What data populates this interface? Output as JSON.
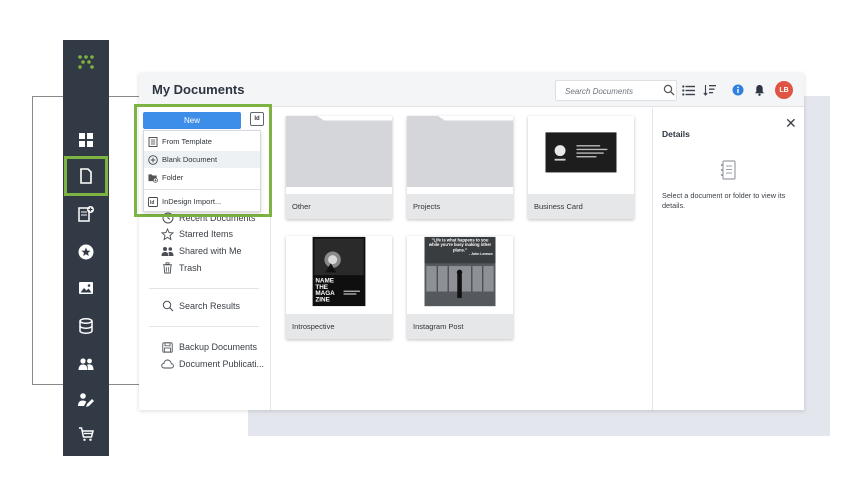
{
  "app": {
    "title": "My Documents",
    "logo_icon": "apps-logo-icon"
  },
  "rail": {
    "items": [
      {
        "icon": "dashboard-icon"
      },
      {
        "icon": "document-icon",
        "active": true
      },
      {
        "icon": "add-document-icon"
      },
      {
        "icon": "star-badge-icon"
      },
      {
        "icon": "image-icon"
      },
      {
        "icon": "database-icon"
      },
      {
        "icon": "users-icon"
      },
      {
        "icon": "user-edit-icon"
      },
      {
        "icon": "cart-icon"
      }
    ],
    "accent": "#7cb342"
  },
  "header": {
    "search_placeholder": "Search Documents",
    "avatar_initials": "LB",
    "avatar_color": "#e05444",
    "info_color": "#2f7fe0"
  },
  "new_menu": {
    "new_label": "New",
    "id_label": "Id",
    "items": [
      {
        "label": "From Template",
        "icon": "template-icon"
      },
      {
        "label": "Blank Document",
        "icon": "plus-circle-icon"
      },
      {
        "label": "Folder",
        "icon": "folder-add-icon"
      },
      {
        "label": "InDesign Import...",
        "icon": "indesign-icon"
      }
    ]
  },
  "sidebar": {
    "items": [
      {
        "label": "Recent Documents",
        "icon": "clock-icon"
      },
      {
        "label": "Starred Items",
        "icon": "star-icon"
      },
      {
        "label": "Shared with Me",
        "icon": "shared-users-icon"
      },
      {
        "label": "Trash",
        "icon": "trash-icon"
      },
      {
        "label": "Search Results",
        "icon": "search-icon"
      },
      {
        "label": "Backup Documents",
        "icon": "backup-icon"
      },
      {
        "label": "Document Publicati...",
        "icon": "cloud-icon"
      }
    ]
  },
  "documents": [
    {
      "label": "Other",
      "kind": "folder"
    },
    {
      "label": "Projects",
      "kind": "folder"
    },
    {
      "label": "Business Card",
      "kind": "document"
    },
    {
      "label": "Introspective",
      "kind": "document"
    },
    {
      "label": "Instagram Post",
      "kind": "document"
    }
  ],
  "thumbs": {
    "magazine_lines": [
      "NAME",
      "THE",
      "MAGA",
      "ZINE"
    ],
    "quote_text": "\"Life is what happens to you while you're busy making other plans.\"",
    "quote_author": "- John Lennon"
  },
  "details": {
    "title": "Details",
    "close_label": "✕",
    "text": "Select a document or folder to view its details."
  }
}
